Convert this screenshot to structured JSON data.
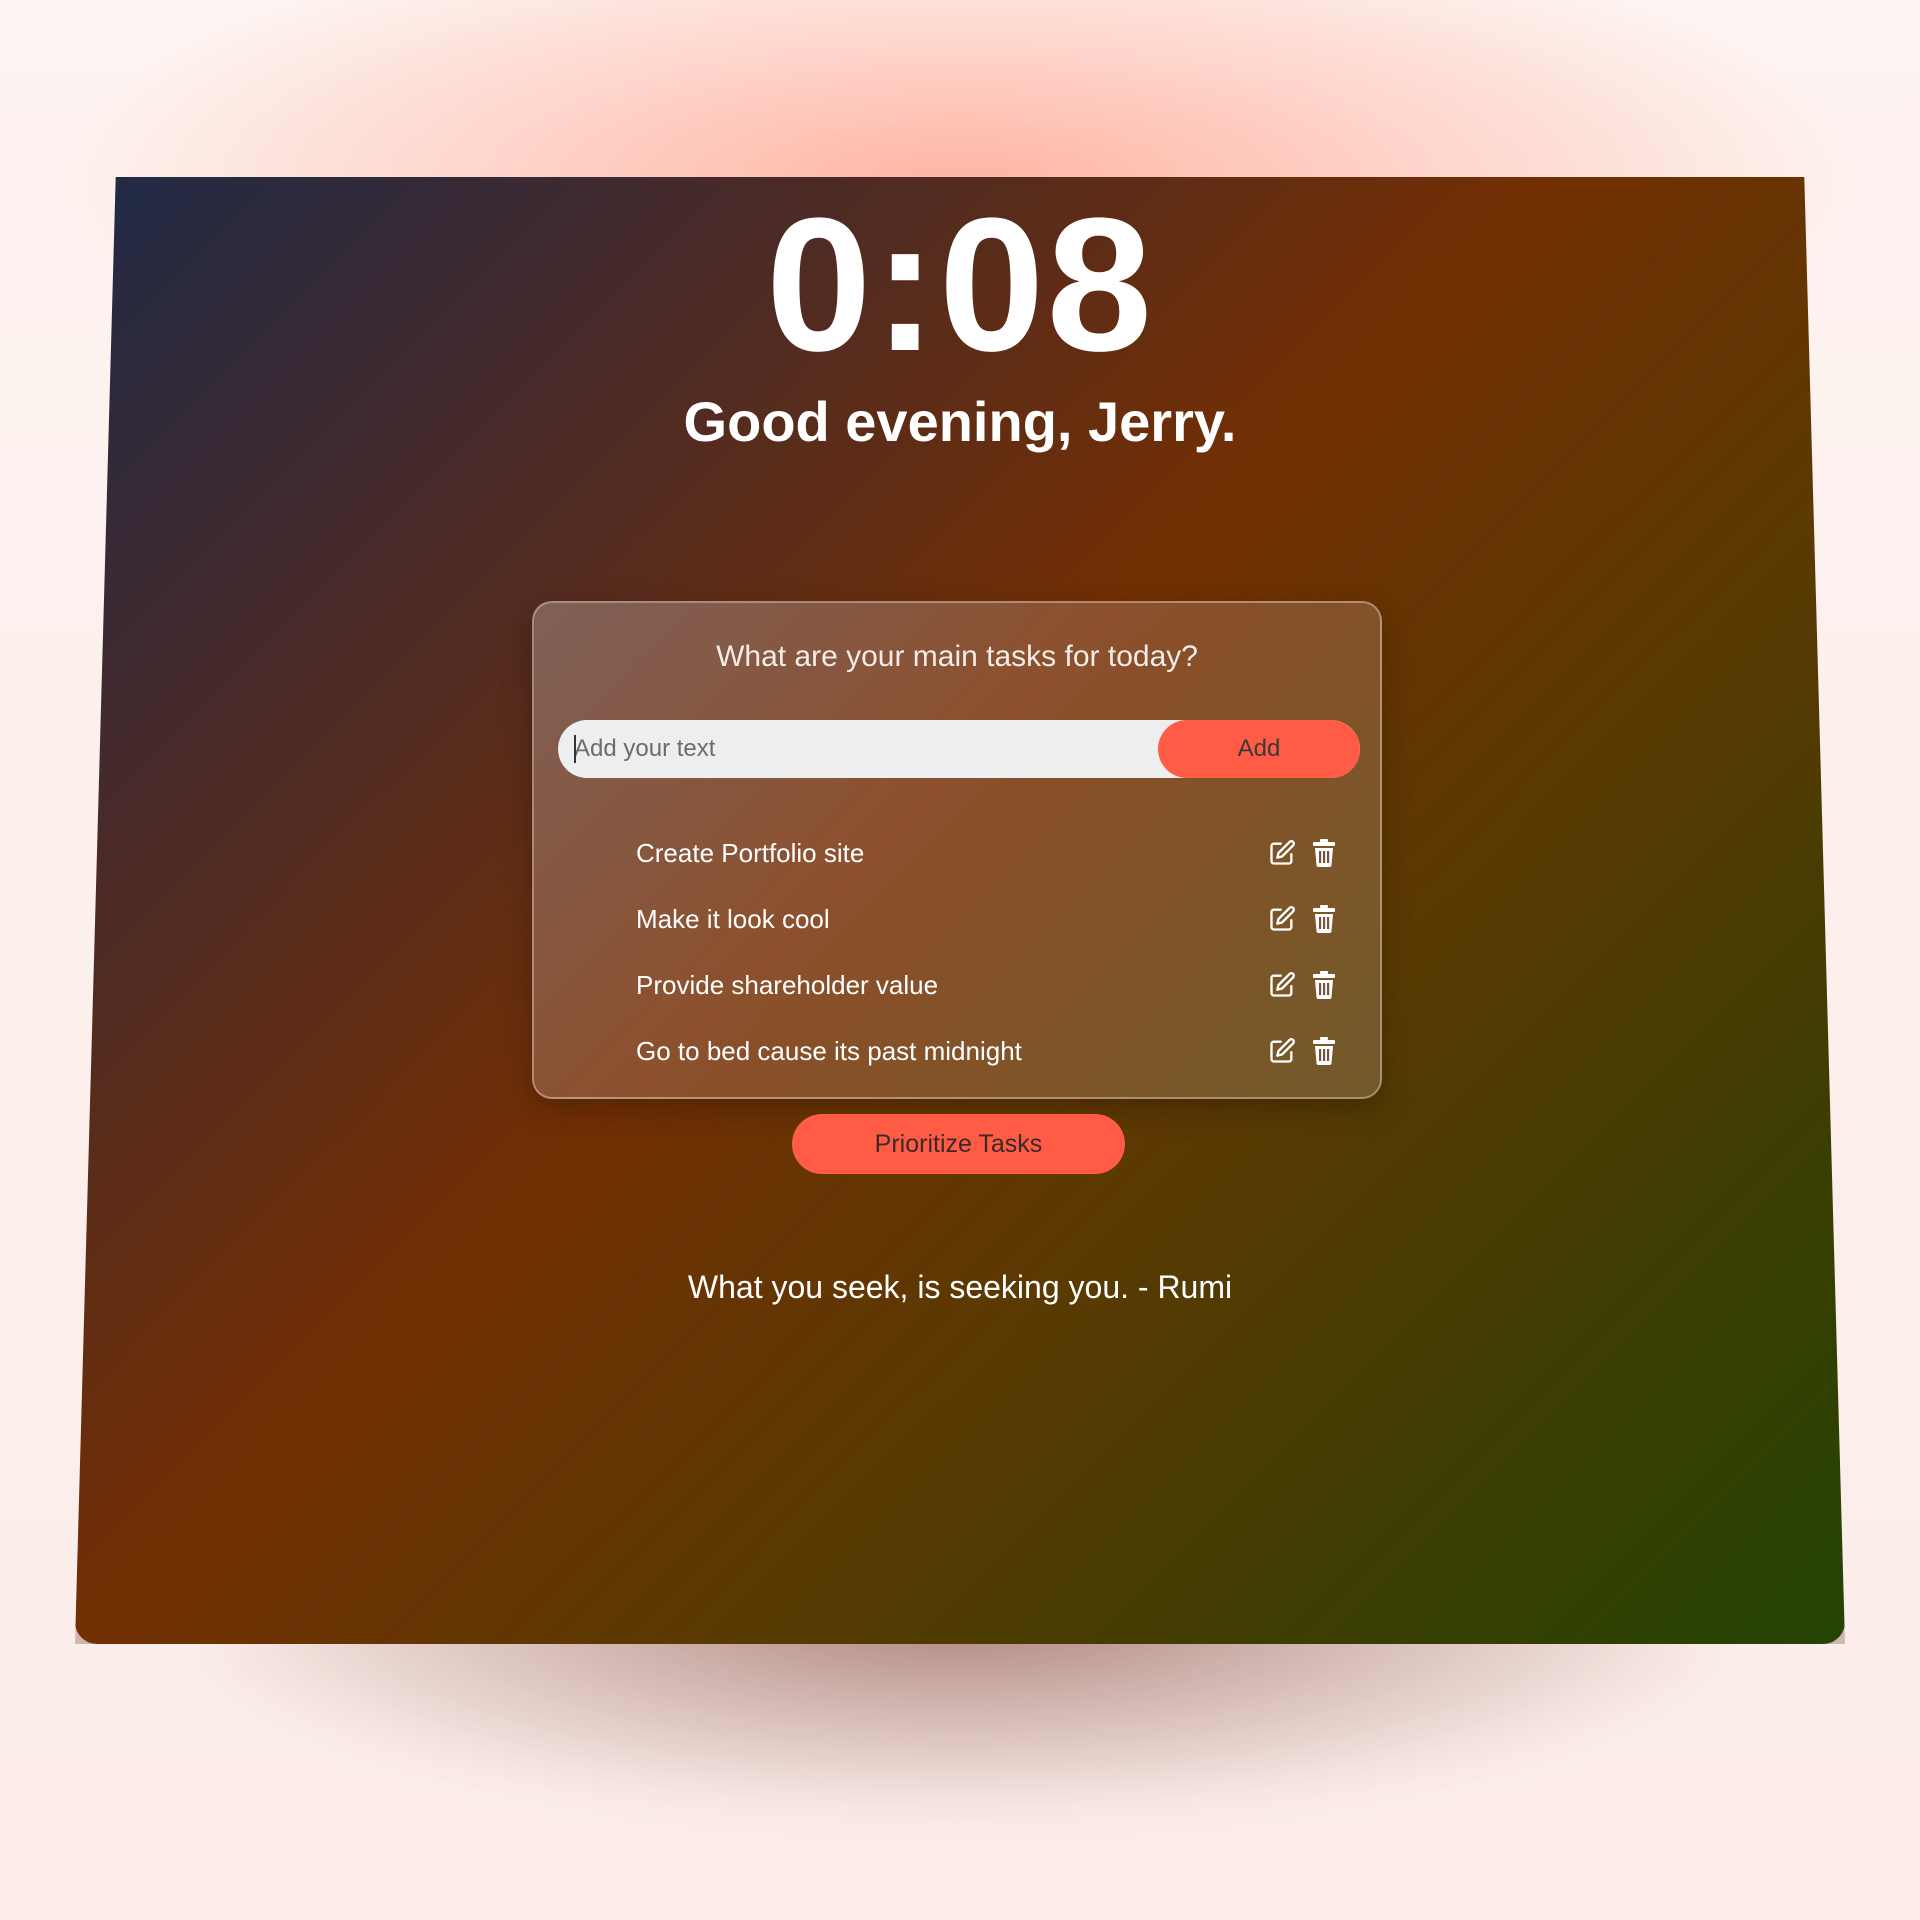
{
  "clock": {
    "time": "0:08"
  },
  "greeting": {
    "text": "Good evening, Jerry."
  },
  "tasks_card": {
    "title": "What are your main tasks for today?",
    "input": {
      "placeholder": "Add your text",
      "value": ""
    },
    "add_label": "Add",
    "items": [
      {
        "label": "Create Portfolio site"
      },
      {
        "label": "Make it look cool"
      },
      {
        "label": "Provide shareholder value"
      },
      {
        "label": "Go to bed cause its past midnight"
      }
    ]
  },
  "prioritize_label": "Prioritize Tasks",
  "quote": {
    "text": "What you seek, is seeking you. - Rumi"
  },
  "icons": {
    "edit": "edit-icon",
    "delete": "trash-icon"
  },
  "colors": {
    "accent": "#ff5b45",
    "text": "#ffffff",
    "input_bg": "#eceef0"
  }
}
